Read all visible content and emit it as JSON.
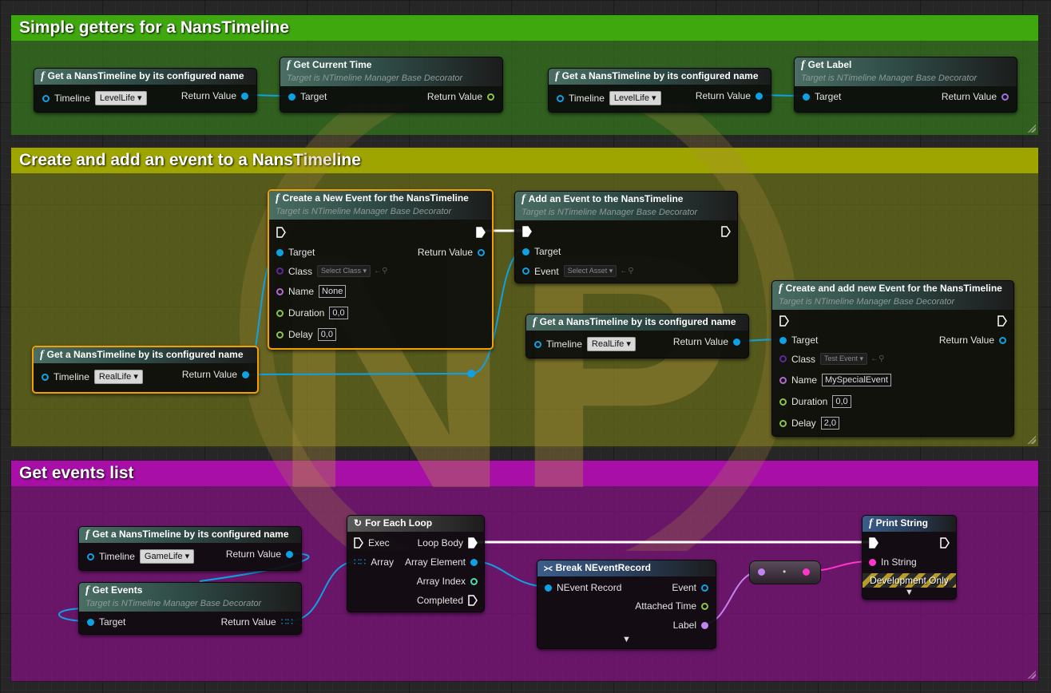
{
  "colors": {
    "comment_green": "#3fa80f",
    "comment_yellow": "#9ea500",
    "comment_magenta": "#a70fa7",
    "object_pin": "#0ea1e3",
    "exec_wire": "#ffffff",
    "string_pin": "#ff36c8"
  },
  "comments": [
    {
      "title": "Simple getters for a NansTimeline"
    },
    {
      "title": "Create and add an event to a NansTimeline"
    },
    {
      "title": "Get events list"
    }
  ],
  "watermark": {
    "text": "NP"
  },
  "labels": {
    "get_by_name": "Get a NansTimeline by its configured name",
    "target_is": "Target is NTimeline Manager Base Decorator",
    "timeline": "Timeline",
    "return_value": "Return Value",
    "target": "Target",
    "class": "Class",
    "name": "Name",
    "duration": "Duration",
    "delay": "Delay",
    "event": "Event"
  },
  "nodes": {
    "get_current_time": {
      "title": "Get Current Time"
    },
    "get_label": {
      "title": "Get Label"
    },
    "create_event": {
      "title": "Create a New Event for the NansTimeline",
      "class_placeholder": "Select Class",
      "name_value": "None",
      "duration_value": "0,0",
      "delay_value": "0,0"
    },
    "add_event": {
      "title": "Add an Event to the NansTimeline",
      "event_placeholder": "Select Asset"
    },
    "create_and_add": {
      "title": "Create and add new Event for the NansTimeline",
      "class_value": "Test Event",
      "name_value": "MySpecialEvent",
      "duration_value": "0,0",
      "delay_value": "2,0"
    },
    "timelines": {
      "levellife": "LevelLife",
      "reallife": "RealLife",
      "gamelife": "GameLife"
    },
    "get_events": {
      "title": "Get Events"
    },
    "for_each": {
      "title": "For Each Loop",
      "exec": "Exec",
      "loop_body": "Loop Body",
      "array": "Array",
      "array_element": "Array Element",
      "array_index": "Array Index",
      "completed": "Completed"
    },
    "break_record": {
      "title": "Break NEventRecord",
      "nevent_record": "NEvent Record",
      "event": "Event",
      "attached_time": "Attached Time",
      "label": "Label"
    },
    "print_string": {
      "title": "Print String",
      "in_string": "In String",
      "dev_only": "Development Only"
    }
  }
}
